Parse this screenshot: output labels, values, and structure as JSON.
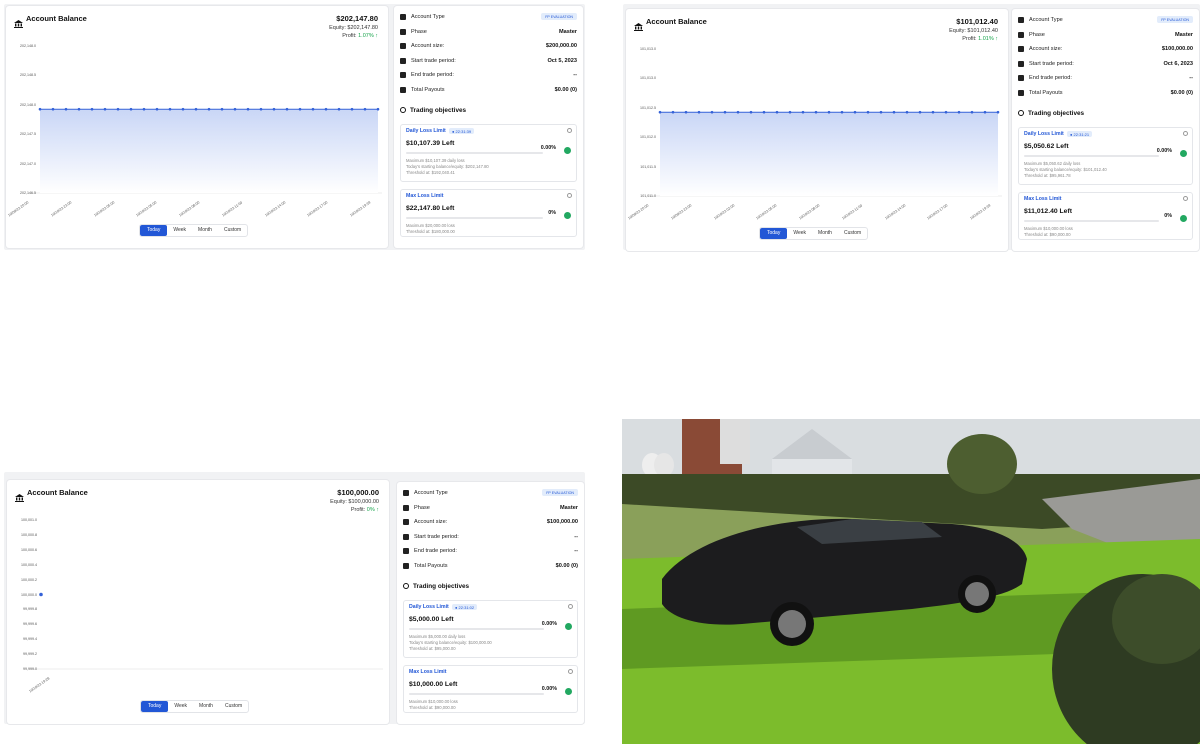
{
  "widgets": [
    {
      "title": "Account Balance",
      "balance": "$202,147.80",
      "equity": "Equity:  $202,147.80",
      "profit_label": "Profit:",
      "profit_pct": "1.07% ↑",
      "y_ticks": [
        "202,148.0",
        "202,148.5",
        "202,148.0",
        "202,147.5",
        "202,147.0",
        "202,146.5"
      ],
      "x_ticks": [
        "10/09/23 20:00",
        "10/10/23 23:00",
        "10/10/23 05:00",
        "10/10/23 05:00",
        "10/10/23 08:00",
        "10/10/23 11:00",
        "10/10/23 14:00",
        "10/10/23 17:00",
        "10/10/23 19:39"
      ],
      "chart_data": {
        "type": "line",
        "y": 202147.8,
        "points": 27
      },
      "tabs": [
        "Today",
        "Week",
        "Month",
        "Custom"
      ],
      "account_type_label": "Account Type",
      "account_type_badge": "FP EVALUATION",
      "phase_label": "Phase",
      "phase_value": "Master",
      "size_label": "Account size:",
      "size_value": "$200,000.00",
      "start_label": "Start trade period:",
      "start_value": "Oct 5, 2023",
      "end_label": "End trade period:",
      "end_value": "--",
      "payouts_label": "Total Payouts",
      "payouts_value": "$0.00 (0)",
      "objectives_title": "Trading objectives",
      "daily": {
        "name": "Daily Loss Limit",
        "timer": "22:31:39",
        "left": "$10,107.39 Left",
        "pct": "0.00%",
        "fill": 0.0,
        "line1": "Maximum $10,107.39 daily loss",
        "line2": "Today's starting balance/equity: $202,147.80",
        "line3": "Threshold at: $192,040.41"
      },
      "max": {
        "name": "Max Loss Limit",
        "left": "$22,147.80 Left",
        "pct": "0%",
        "fill": 0.0,
        "line1": "Maximum $20,000.00 loss",
        "line2": "Threshold at: $180,000.00"
      }
    },
    {
      "title": "Account Balance",
      "balance": "$101,012.40",
      "equity": "Equity:  $101,012.40",
      "profit_label": "Profit:",
      "profit_pct": "1.01% ↑",
      "y_ticks": [
        "101,013.0",
        "101,013.0",
        "101,012.5",
        "101,012.0",
        "101,011.5",
        "101,011.0"
      ],
      "x_ticks": [
        "10/09/23 20:00",
        "10/09/23 23:00",
        "10/10/23 02:00",
        "10/10/23 05:00",
        "10/10/23 08:00",
        "10/10/23 11:00",
        "10/10/23 14:00",
        "10/10/23 17:00",
        "10/10/23 19:39"
      ],
      "chart_data": {
        "type": "line",
        "y": 101012.4,
        "points": 27
      },
      "tabs": [
        "Today",
        "Week",
        "Month",
        "Custom"
      ],
      "account_type_label": "Account Type",
      "account_type_badge": "FP EVALUATION",
      "phase_label": "Phase",
      "phase_value": "Master",
      "size_label": "Account size:",
      "size_value": "$100,000.00",
      "start_label": "Start trade period:",
      "start_value": "Oct 6, 2023",
      "end_label": "End trade period:",
      "end_value": "--",
      "payouts_label": "Total Payouts",
      "payouts_value": "$0.00 (0)",
      "objectives_title": "Trading objectives",
      "daily": {
        "name": "Daily Loss Limit",
        "timer": "22:31:21",
        "left": "$5,050.62 Left",
        "pct": "0.00%",
        "fill": 0.0,
        "line1": "Maximum $5,050.62 daily loss",
        "line2": "Today's starting balance/equity: $101,012.40",
        "line3": "Threshold at: $95,961.78"
      },
      "max": {
        "name": "Max Loss Limit",
        "left": "$11,012.40 Left",
        "pct": "0%",
        "fill": 0.0,
        "line1": "Maximum $10,000.00 loss",
        "line2": "Threshold at: $90,000.00"
      }
    },
    {
      "title": "Account Balance",
      "balance": "$100,000.00",
      "equity": "Equity:  $100,000.00",
      "profit_label": "Profit:",
      "profit_pct": "0% ↑",
      "y_ticks": [
        "100,001.0",
        "100,000.8",
        "100,000.6",
        "100,000.4",
        "100,000.2",
        "100,000.0",
        "99,999.8",
        "99,999.6",
        "99,999.4",
        "99,999.2",
        "99,999.0"
      ],
      "x_ticks": [
        "10/10/23 19:28"
      ],
      "chart_data": {
        "type": "scatter",
        "y": 100000.0,
        "points": 1
      },
      "tabs": [
        "Today",
        "Week",
        "Month",
        "Custom"
      ],
      "account_type_label": "Account Type",
      "account_type_badge": "FP EVALUATION",
      "phase_label": "Phase",
      "phase_value": "Master",
      "size_label": "Account size:",
      "size_value": "$100,000.00",
      "start_label": "Start trade period:",
      "start_value": "--",
      "end_label": "End trade period:",
      "end_value": "--",
      "payouts_label": "Total Payouts",
      "payouts_value": "$0.00 (0)",
      "objectives_title": "Trading objectives",
      "daily": {
        "name": "Daily Loss Limit",
        "timer": "22:31:02",
        "left": "$5,000.00 Left",
        "pct": "0.00%",
        "fill": 0.0,
        "line1": "Maximum $5,000.00 daily loss",
        "line2": "Today's starting balance/equity: $100,000.00",
        "line3": "Threshold at: $95,000.00"
      },
      "max": {
        "name": "Max Loss Limit",
        "left": "$10,000.00 Left",
        "pct": "0.00%",
        "fill": 0.0,
        "line1": "Maximum $10,000.00 loss",
        "line2": "Threshold at: $90,000.00"
      }
    }
  ],
  "photo": {
    "subject": "black muscle car parked on a lawn"
  }
}
